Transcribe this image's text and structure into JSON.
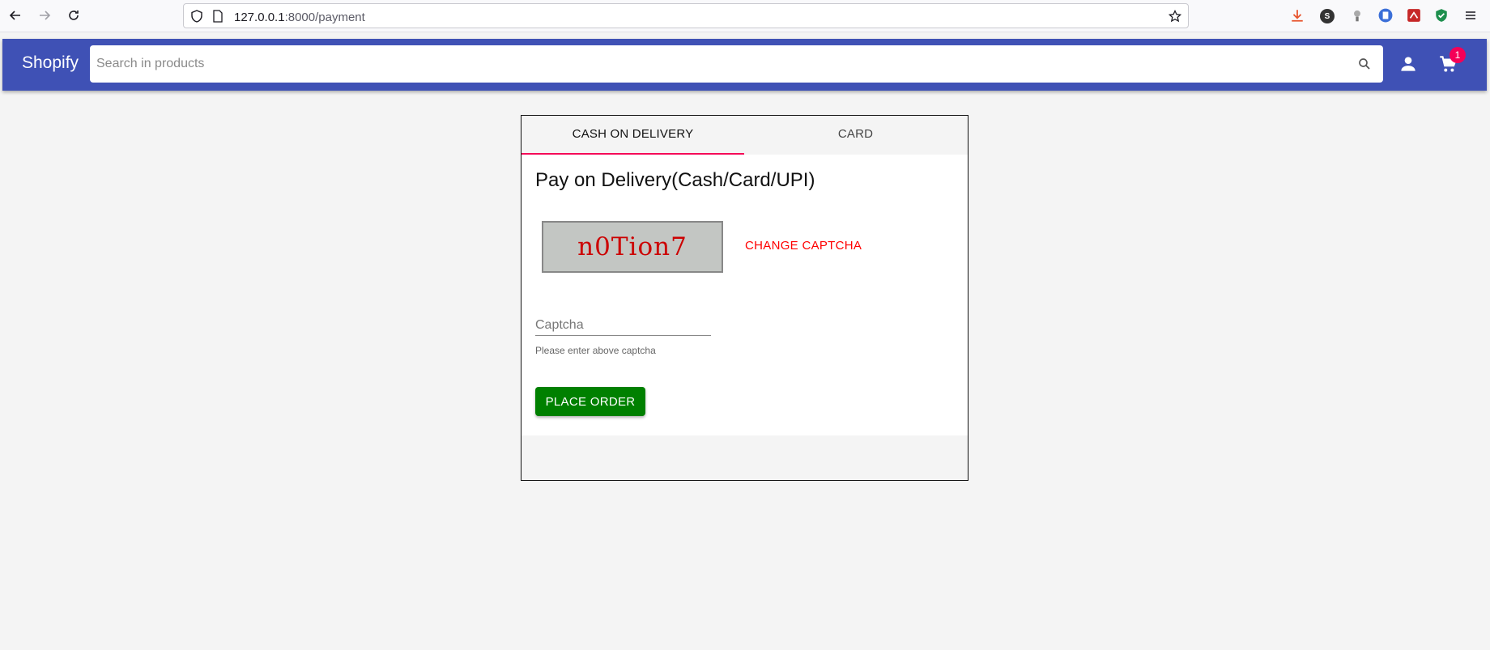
{
  "browser": {
    "url_host": "127.0.0.1",
    "url_rest": ":8000/payment",
    "extension_badge_s": "S"
  },
  "header": {
    "brand": "Shopify",
    "search_placeholder": "Search in products",
    "cart_count": "1",
    "colors": {
      "app_bar": "#3f51b5",
      "badge": "#f50057"
    }
  },
  "payment": {
    "tabs": [
      {
        "label": "CASH ON DELIVERY",
        "active": true
      },
      {
        "label": "CARD",
        "active": false
      }
    ],
    "title": "Pay on Delivery(Cash/Card/UPI)",
    "captcha_text": "n0Tion7",
    "change_captcha_label": "CHANGE CAPTCHA",
    "captcha_placeholder": "Captcha",
    "captcha_helper": "Please enter above captcha",
    "place_order_label": "PLACE ORDER",
    "colors": {
      "tab_indicator": "#f50057",
      "place_order": "#008000",
      "change_captcha": "#ff0000"
    }
  }
}
